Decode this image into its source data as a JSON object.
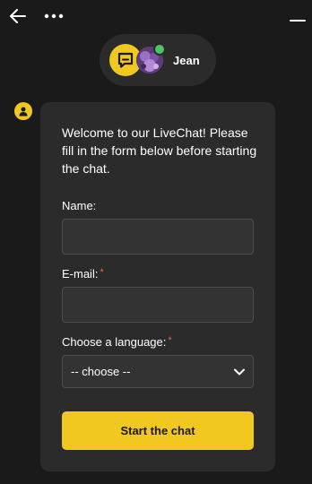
{
  "header": {
    "back_icon": "arrow-left-icon",
    "more_icon": "more-horizontal-icon",
    "minimize_icon": "minimize-icon"
  },
  "agent": {
    "name": "Jean",
    "status": "online",
    "status_color": "#4cc46a",
    "brand_icon": "chat-bubble-icon"
  },
  "form": {
    "welcome_text": "Welcome to our LiveChat! Please fill in the form below before starting the chat.",
    "name_label": "Name:",
    "name_value": "",
    "email_label": "E-mail:",
    "email_required_mark": "*",
    "email_value": "",
    "language_label": "Choose a language:",
    "language_required_mark": "*",
    "language_selected": "-- choose --",
    "submit_label": "Start the chat"
  },
  "colors": {
    "accent": "#f1c820",
    "background": "#1a1a1a",
    "card": "#2b2b2b",
    "input": "#333333",
    "required": "#e8604c"
  }
}
